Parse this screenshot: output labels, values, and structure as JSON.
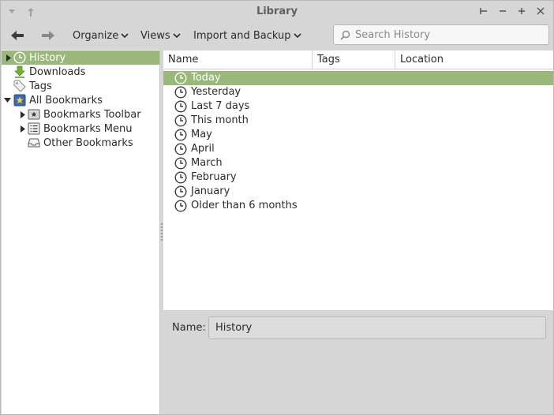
{
  "window": {
    "title": "Library",
    "controls": [
      "minimize-to-corner",
      "minimize",
      "maximize",
      "close"
    ]
  },
  "toolbar": {
    "organize_label": "Organize",
    "views_label": "Views",
    "import_backup_label": "Import and Backup",
    "search_placeholder": "Search History"
  },
  "sidebar": {
    "items": [
      {
        "label": "History",
        "icon": "clock-icon",
        "selected": true
      },
      {
        "label": "Downloads",
        "icon": "download-arrow-icon"
      },
      {
        "label": "Tags",
        "icon": "tag-icon"
      },
      {
        "label": "All Bookmarks",
        "icon": "bookmarks-star-icon"
      },
      {
        "label": "Bookmarks Toolbar",
        "icon": "toolbar-star-icon"
      },
      {
        "label": "Bookmarks Menu",
        "icon": "menu-list-icon"
      },
      {
        "label": "Other Bookmarks",
        "icon": "tray-icon"
      }
    ]
  },
  "table": {
    "columns": [
      "Name",
      "Tags",
      "Location"
    ],
    "rows": [
      {
        "name": "Today",
        "selected": true
      },
      {
        "name": "Yesterday"
      },
      {
        "name": "Last 7 days"
      },
      {
        "name": "This month"
      },
      {
        "name": "May"
      },
      {
        "name": "April"
      },
      {
        "name": "March"
      },
      {
        "name": "February"
      },
      {
        "name": "January"
      },
      {
        "name": "Older than 6 months"
      }
    ]
  },
  "details": {
    "name_label": "Name:",
    "name_value": "History"
  },
  "colors": {
    "selection": "#9ab87a",
    "window_bg": "#d6d6d6"
  }
}
